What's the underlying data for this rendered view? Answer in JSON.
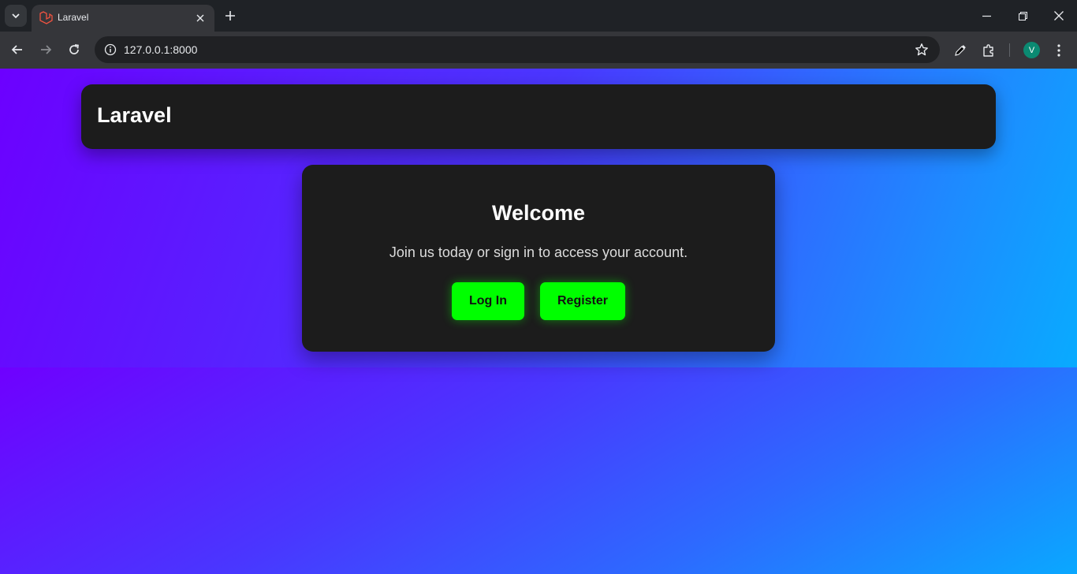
{
  "browser": {
    "tab": {
      "title": "Laravel"
    },
    "address_bar": {
      "url": "127.0.0.1:8000"
    },
    "profile": {
      "initial": "V",
      "color": "#0b8a72"
    }
  },
  "page": {
    "header": {
      "title": "Laravel"
    },
    "welcome": {
      "heading": "Welcome",
      "subtitle": "Join us today or sign in to access your account.",
      "login_label": "Log In",
      "register_label": "Register"
    }
  },
  "colors": {
    "accent_button": "#00ff00",
    "card_background": "#1c1c1c",
    "gradient_start": "#6c00ff",
    "gradient_end": "#00b8ff"
  }
}
